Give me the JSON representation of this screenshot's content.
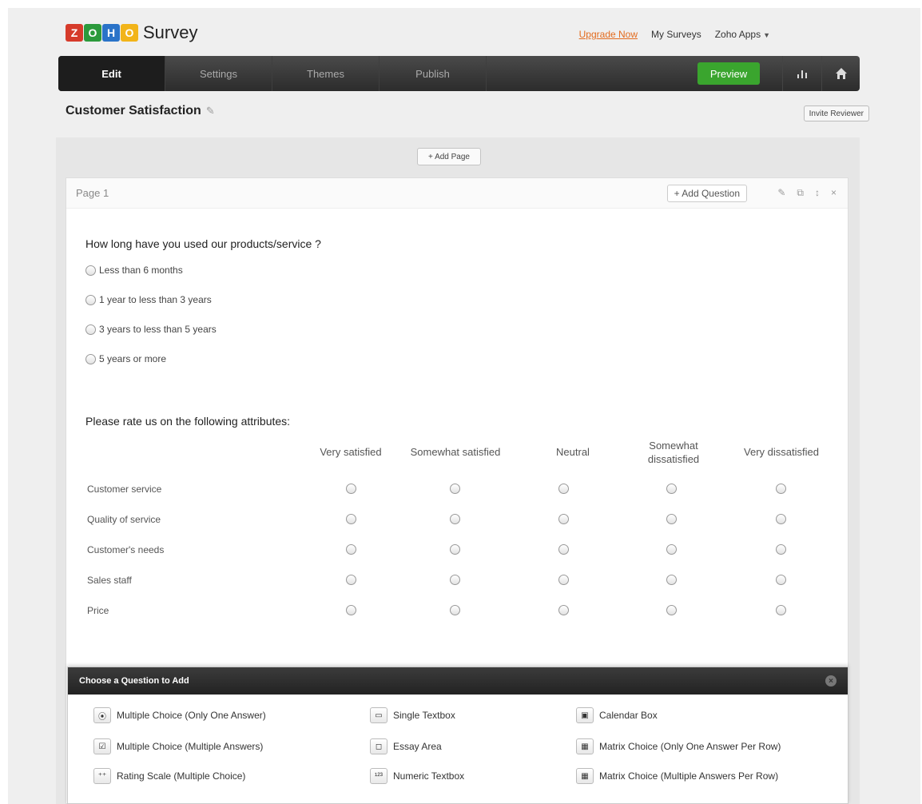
{
  "brand": {
    "letters": [
      "Z",
      "O",
      "H",
      "O"
    ],
    "name": "Survey"
  },
  "toplinks": {
    "upgrade": "Upgrade Now",
    "my_surveys": "My Surveys",
    "zoho_apps": "Zoho Apps"
  },
  "nav": {
    "tabs": [
      "Edit",
      "Settings",
      "Themes",
      "Publish"
    ],
    "active": "Edit",
    "preview": "Preview",
    "icons": [
      "reports-icon",
      "home-icon"
    ]
  },
  "survey": {
    "title": "Customer Satisfaction",
    "invite": "Invite Reviewer",
    "add_page": "+ Add Page"
  },
  "page": {
    "title": "Page 1",
    "add_question": "+ Add Question",
    "tools": [
      "edit-icon",
      "copy-icon",
      "move-icon",
      "delete-icon"
    ]
  },
  "question1": {
    "text": "How long have you used our products/service ?",
    "options": [
      "Less than 6 months",
      "1 year to less than 3 years",
      "3 years to less than 5 years",
      "5 years or more"
    ]
  },
  "question2": {
    "text": "Please rate us on the following attributes:",
    "columns": [
      "Very satisfied",
      "Somewhat satisfied",
      "Neutral",
      "Somewhat dissatisfied",
      "Very dissatisfied"
    ],
    "rows": [
      "Customer service",
      "Quality of service",
      "Customer's needs",
      "Sales staff",
      "Price"
    ]
  },
  "chooser": {
    "title": "Choose a Question to Add",
    "types": [
      {
        "label": "Multiple Choice (Only One Answer)",
        "icon": "radio-icon"
      },
      {
        "label": "Single Textbox",
        "icon": "textbox-icon"
      },
      {
        "label": "Calendar Box",
        "icon": "calendar-icon"
      },
      {
        "label": "Multiple Choice (Multiple Answers)",
        "icon": "checkbox-icon"
      },
      {
        "label": "Essay Area",
        "icon": "textarea-icon"
      },
      {
        "label": "Matrix Choice (Only One Answer Per Row)",
        "icon": "matrix-icon"
      },
      {
        "label": "Rating Scale (Multiple Choice)",
        "icon": "rating-icon"
      },
      {
        "label": "Numeric Textbox",
        "icon": "numeric-icon"
      },
      {
        "label": "Matrix Choice (Multiple Answers Per Row)",
        "icon": "matrix-multi-icon"
      }
    ]
  }
}
